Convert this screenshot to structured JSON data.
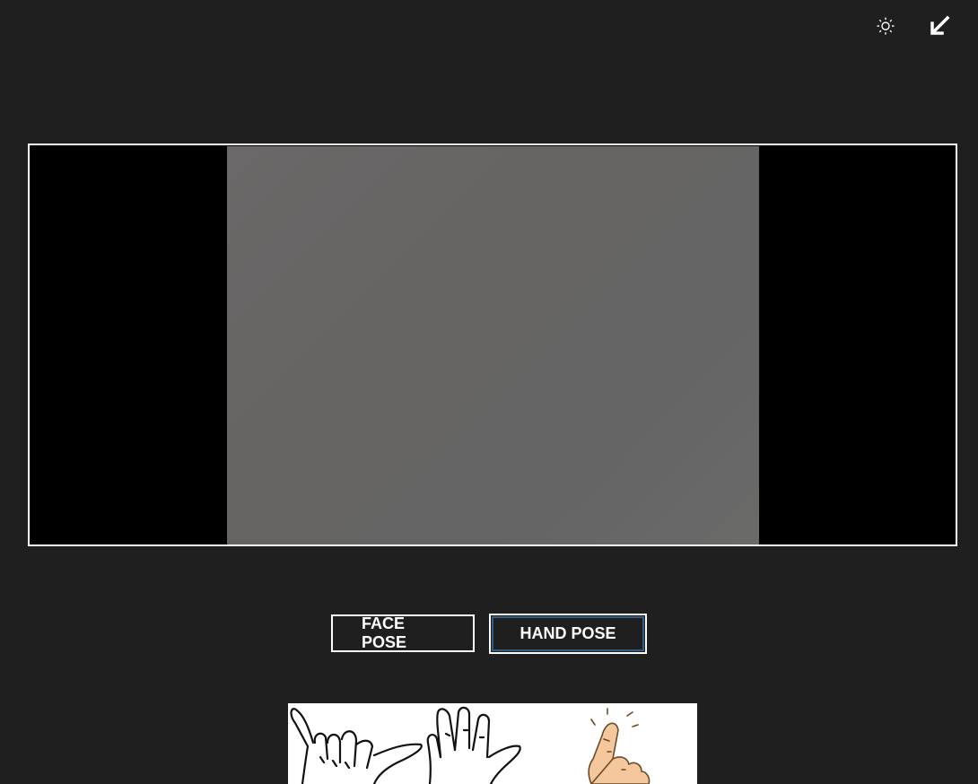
{
  "toolbar": {
    "brightness_icon": "sun-icon",
    "collapse_icon": "arrow-down-left-icon"
  },
  "buttons": {
    "face_pose": "FACE POSE",
    "hand_pose": "HAND POSE"
  },
  "colors": {
    "background": "#1f1f1f",
    "frame_border": "#ffffff",
    "focus_outline": "#2e5d8a"
  }
}
